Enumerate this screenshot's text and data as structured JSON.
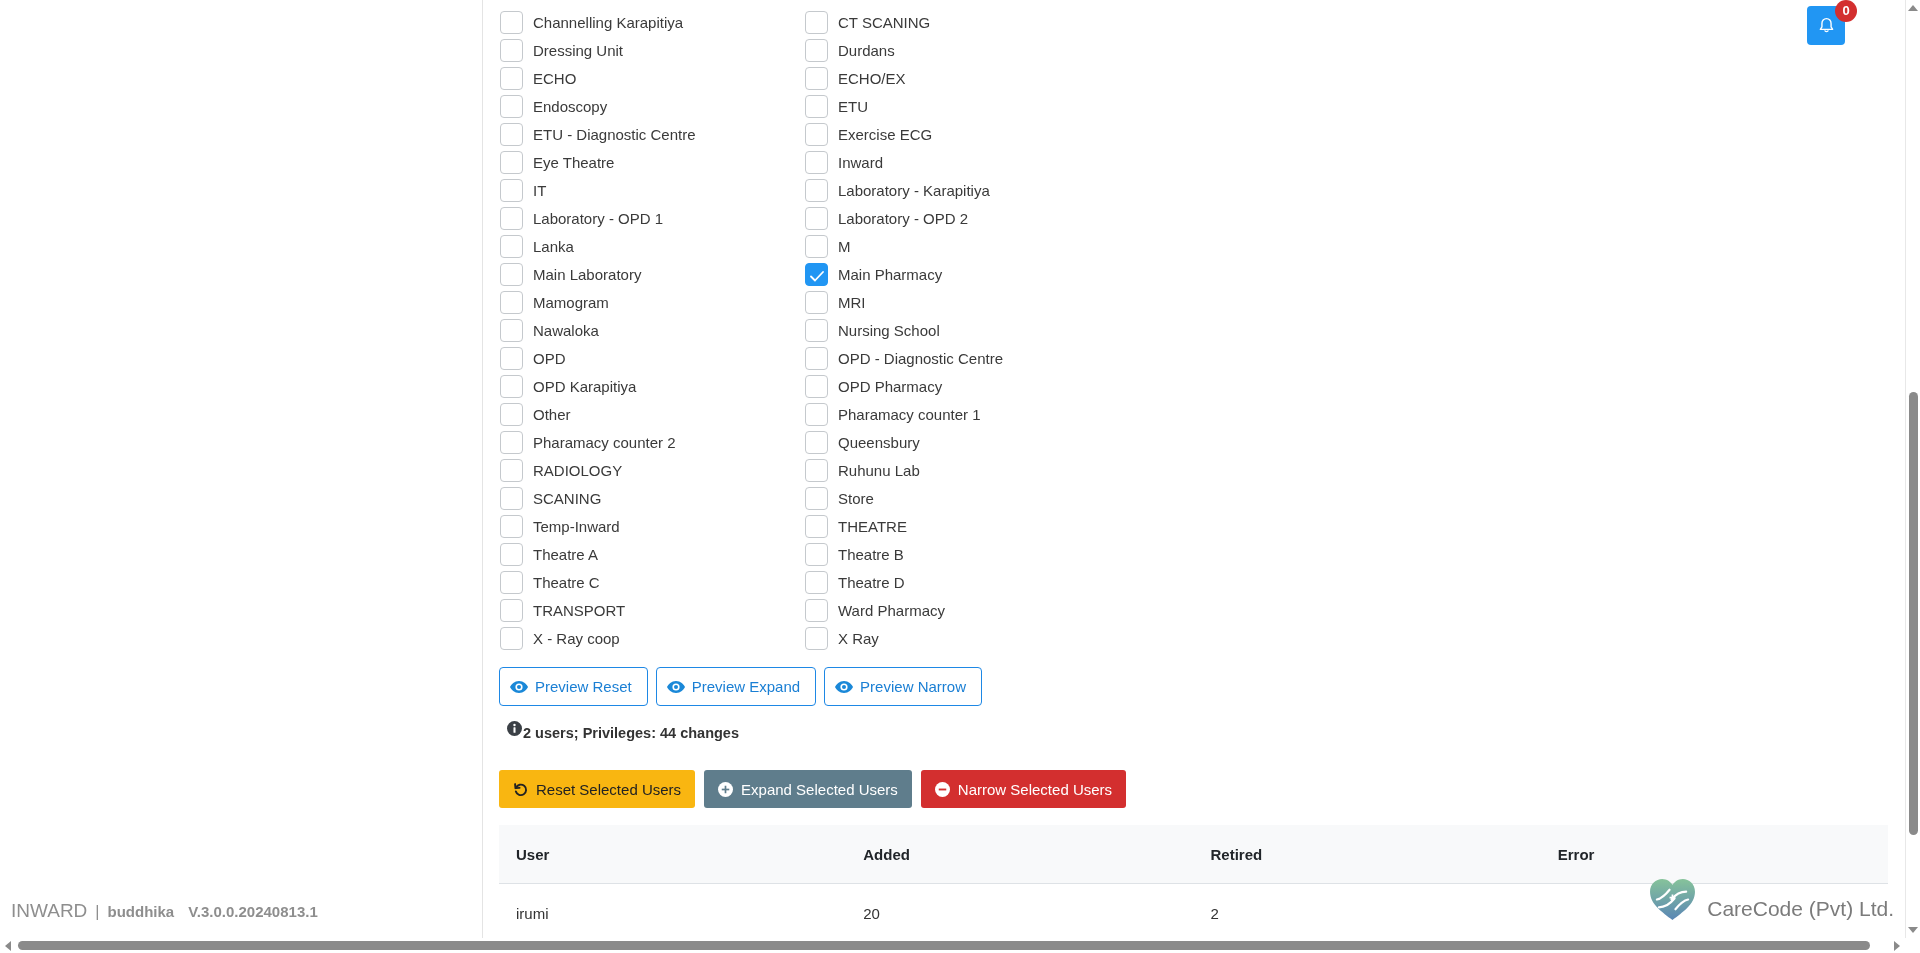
{
  "notification": {
    "count": "0"
  },
  "departments": [
    {
      "label": "Channelling Karapitiya",
      "checked": false
    },
    {
      "label": "CT SCANING",
      "checked": false
    },
    {
      "label": "Dressing Unit",
      "checked": false
    },
    {
      "label": "Durdans",
      "checked": false
    },
    {
      "label": "ECHO",
      "checked": false
    },
    {
      "label": "ECHO/EX",
      "checked": false
    },
    {
      "label": "Endoscopy",
      "checked": false
    },
    {
      "label": "ETU",
      "checked": false
    },
    {
      "label": "ETU - Diagnostic Centre",
      "checked": false
    },
    {
      "label": "Exercise ECG",
      "checked": false
    },
    {
      "label": "Eye Theatre",
      "checked": false
    },
    {
      "label": "Inward",
      "checked": false
    },
    {
      "label": "IT",
      "checked": false
    },
    {
      "label": "Laboratory - Karapitiya",
      "checked": false
    },
    {
      "label": "Laboratory - OPD 1",
      "checked": false
    },
    {
      "label": "Laboratory - OPD 2",
      "checked": false
    },
    {
      "label": "Lanka",
      "checked": false
    },
    {
      "label": "M",
      "checked": false
    },
    {
      "label": "Main Laboratory",
      "checked": false
    },
    {
      "label": "Main Pharmacy",
      "checked": true
    },
    {
      "label": "Mamogram",
      "checked": false
    },
    {
      "label": "MRI",
      "checked": false
    },
    {
      "label": "Nawaloka",
      "checked": false
    },
    {
      "label": "Nursing School",
      "checked": false
    },
    {
      "label": "OPD",
      "checked": false
    },
    {
      "label": "OPD - Diagnostic Centre",
      "checked": false
    },
    {
      "label": "OPD Karapitiya",
      "checked": false
    },
    {
      "label": "OPD Pharmacy",
      "checked": false
    },
    {
      "label": "Other",
      "checked": false
    },
    {
      "label": "Pharamacy counter 1",
      "checked": false
    },
    {
      "label": "Pharamacy counter 2",
      "checked": false
    },
    {
      "label": "Queensbury",
      "checked": false
    },
    {
      "label": "RADIOLOGY",
      "checked": false
    },
    {
      "label": "Ruhunu Lab",
      "checked": false
    },
    {
      "label": "SCANING",
      "checked": false
    },
    {
      "label": "Store",
      "checked": false
    },
    {
      "label": "Temp-Inward",
      "checked": false
    },
    {
      "label": "THEATRE",
      "checked": false
    },
    {
      "label": "Theatre A",
      "checked": false
    },
    {
      "label": "Theatre B",
      "checked": false
    },
    {
      "label": "Theatre C",
      "checked": false
    },
    {
      "label": "Theatre D",
      "checked": false
    },
    {
      "label": "TRANSPORT",
      "checked": false
    },
    {
      "label": "Ward Pharmacy",
      "checked": false
    },
    {
      "label": "X - Ray coop",
      "checked": false
    },
    {
      "label": "X Ray",
      "checked": false
    }
  ],
  "preview_buttons": [
    {
      "label": "Preview Reset"
    },
    {
      "label": "Preview Expand"
    },
    {
      "label": "Preview Narrow"
    }
  ],
  "summary": "2 users; Privileges: 44 changes",
  "action_buttons": [
    {
      "label": "Reset Selected Users",
      "kind": "reset"
    },
    {
      "label": "Expand Selected Users",
      "kind": "expand"
    },
    {
      "label": "Narrow Selected Users",
      "kind": "narrow"
    }
  ],
  "table": {
    "columns": [
      "User",
      "Added",
      "Retired",
      "Error"
    ],
    "rows": [
      [
        "irumi",
        "20",
        "2"
      ]
    ]
  },
  "footer": {
    "app": "INWARD",
    "separator": "|",
    "user": "buddhika",
    "version": "V.3.0.0.20240813.1"
  },
  "branding": {
    "company": "CareCode (Pvt) Ltd."
  }
}
